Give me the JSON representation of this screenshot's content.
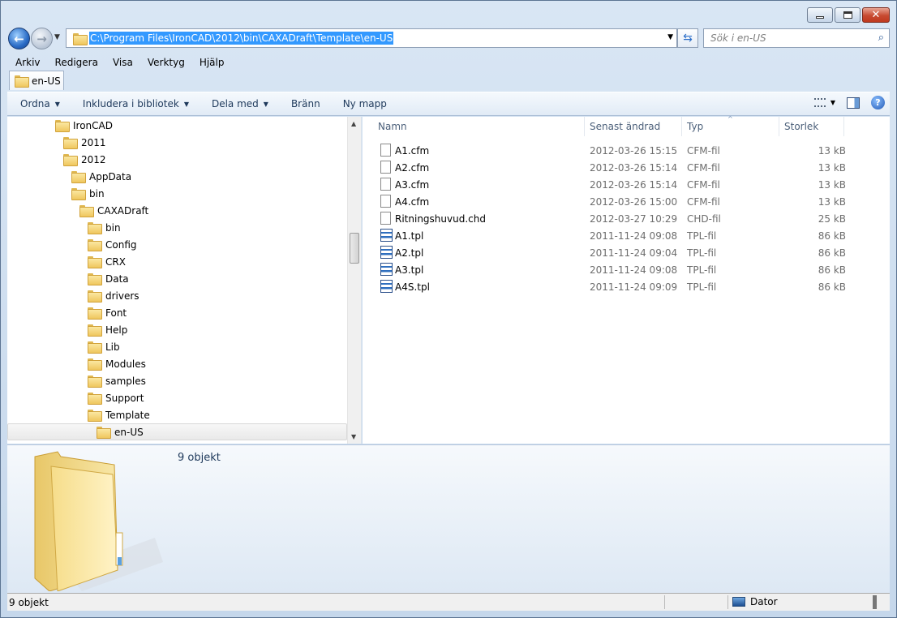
{
  "window": {
    "title": "en-US"
  },
  "address": {
    "path": "C:\\Program Files\\IronCAD\\2012\\bin\\CAXADraft\\Template\\en-US"
  },
  "search": {
    "placeholder": "Sök i en-US"
  },
  "menu": [
    "Arkiv",
    "Redigera",
    "Visa",
    "Verktyg",
    "Hjälp"
  ],
  "tab": {
    "label": "en-US"
  },
  "toolbar": {
    "organize": "Ordna",
    "include_library": "Inkludera i bibliotek",
    "share_with": "Dela med",
    "burn": "Bränn",
    "new_folder": "Ny mapp"
  },
  "tree": [
    {
      "label": "IronCAD",
      "indent": 0
    },
    {
      "label": "2011",
      "indent": 1
    },
    {
      "label": "2012",
      "indent": 1
    },
    {
      "label": "AppData",
      "indent": 2
    },
    {
      "label": "bin",
      "indent": 2
    },
    {
      "label": "CAXADraft",
      "indent": 3
    },
    {
      "label": "bin",
      "indent": 4
    },
    {
      "label": "Config",
      "indent": 4
    },
    {
      "label": "CRX",
      "indent": 4
    },
    {
      "label": "Data",
      "indent": 4
    },
    {
      "label": "drivers",
      "indent": 4
    },
    {
      "label": "Font",
      "indent": 4
    },
    {
      "label": "Help",
      "indent": 4
    },
    {
      "label": "Lib",
      "indent": 4
    },
    {
      "label": "Modules",
      "indent": 4
    },
    {
      "label": "samples",
      "indent": 4
    },
    {
      "label": "Support",
      "indent": 4
    },
    {
      "label": "Template",
      "indent": 4
    },
    {
      "label": "en-US",
      "indent": 5,
      "selected": true
    }
  ],
  "columns": {
    "name": "Namn",
    "date": "Senast ändrad",
    "type": "Typ",
    "size": "Storlek"
  },
  "files": [
    {
      "name": "A1.cfm",
      "date": "2012-03-26 15:15",
      "type": "CFM-fil",
      "size": "13 kB",
      "icon": "document-icon"
    },
    {
      "name": "A2.cfm",
      "date": "2012-03-26 15:14",
      "type": "CFM-fil",
      "size": "13 kB",
      "icon": "document-icon"
    },
    {
      "name": "A3.cfm",
      "date": "2012-03-26 15:14",
      "type": "CFM-fil",
      "size": "13 kB",
      "icon": "document-icon"
    },
    {
      "name": "A4.cfm",
      "date": "2012-03-26 15:00",
      "type": "CFM-fil",
      "size": "13 kB",
      "icon": "document-icon"
    },
    {
      "name": "Ritningshuvud.chd",
      "date": "2012-03-27 10:29",
      "type": "CHD-fil",
      "size": "25 kB",
      "icon": "document-icon"
    },
    {
      "name": "A1.tpl",
      "date": "2011-11-24 09:08",
      "type": "TPL-fil",
      "size": "86 kB",
      "icon": "template-icon"
    },
    {
      "name": "A2.tpl",
      "date": "2011-11-24 09:04",
      "type": "TPL-fil",
      "size": "86 kB",
      "icon": "template-icon"
    },
    {
      "name": "A3.tpl",
      "date": "2011-11-24 09:08",
      "type": "TPL-fil",
      "size": "86 kB",
      "icon": "template-icon"
    },
    {
      "name": "A4S.tpl",
      "date": "2011-11-24 09:09",
      "type": "TPL-fil",
      "size": "86 kB",
      "icon": "template-icon"
    }
  ],
  "details": {
    "count": "9 objekt"
  },
  "status": {
    "left": "9 objekt",
    "right": "Dator"
  }
}
